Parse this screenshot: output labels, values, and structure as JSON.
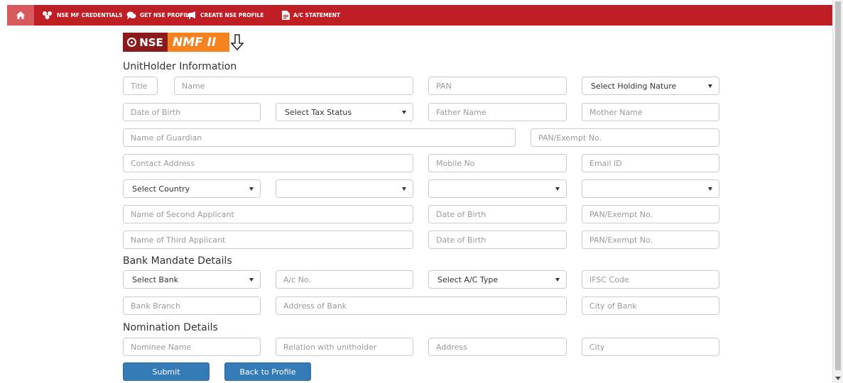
{
  "nav": {
    "items": [
      {
        "label": "NSE MF CREDENTIALS"
      },
      {
        "label": "GET NSE PROFILE"
      },
      {
        "label": "CREATE NSE PROFILE"
      },
      {
        "label": "A/C STATEMENT"
      }
    ],
    "color": "#bf1e24"
  },
  "logo": {
    "left": "NSE",
    "right": "NMF II"
  },
  "unitholder": {
    "title": "UnitHolder Information",
    "placeholders": {
      "title": "Title",
      "name": "Name",
      "pan": "PAN",
      "dob": "Date of Birth",
      "father": "Father Name",
      "mother": "Mother Name",
      "guardian": "Name of Guardian",
      "guardian_pan": "PAN/Exempt No.",
      "address": "Contact Address",
      "mobile": "Mobile No",
      "email": "Email ID",
      "second": "Name of Second Applicant",
      "second_dob": "Date of Birth",
      "second_pan": "PAN/Exempt No.",
      "third": "Name of Third Applicant",
      "third_dob": "Date of Birth",
      "third_pan": "PAN/Exempt No."
    },
    "selects": {
      "holding_nature": "Select Holding Nature",
      "tax_status": "Select Tax Status",
      "country": "Select Country",
      "state": "",
      "city": "",
      "pincode": ""
    }
  },
  "bank": {
    "title": "Bank Mandate Details",
    "select_bank": "Select Bank",
    "select_ac_type": "Select A/C Type",
    "placeholders": {
      "ac_no": "A/c No.",
      "ifsc": "IFSC Code",
      "branch": "Bank Branch",
      "address": "Address of Bank",
      "city": "City of Bank"
    }
  },
  "nomination": {
    "title": "Nomination Details",
    "placeholders": {
      "name": "Nominee Name",
      "relation": "Relation with unitholder",
      "address": "Address",
      "city": "City"
    }
  },
  "buttons": {
    "submit": "Submit",
    "back": "Back to Profile",
    "color": "#337ab7"
  }
}
